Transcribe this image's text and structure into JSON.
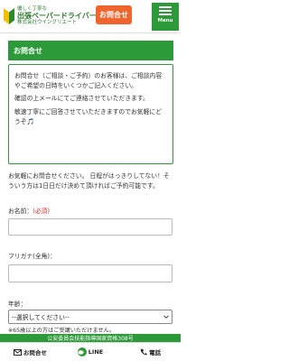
{
  "header": {
    "logo_tagline": "優しく丁寧な",
    "logo_name": "出張ペーパードライバー講習",
    "logo_company": "株式会社ウイングリエート",
    "contact_label": "お問合せ",
    "menu_label": "Menu"
  },
  "section_title": "お問合せ",
  "notice": {
    "p1": "お問合せ（ご相談・ご予約）のお客様は、ご相談内容やご希望の日時をいくつかご記入ください。",
    "p2": "確認の上メールにてご連絡させていただきます。",
    "p3": "敏速丁寧にご回答させていただきますのでお気軽にどうぞ🎵"
  },
  "intro": "お気軽にお問合せください。 日程がはっきりしてない！そういう方は1日日だけ決めて頂ければご予約可能です。",
  "form": {
    "name_label": "お名前：",
    "required_mark": "(必須)",
    "furigana_label": "フリガナ(全角)：",
    "age_label": "年齢：",
    "age_select_value": "--選択してください--",
    "age_note": "※65歳以上の方はご受講いただけません。"
  },
  "footer_band": "公安委員会技能指導国家資格308号",
  "bottom_nav": {
    "contact": "お問合せ",
    "line": "LINE",
    "phone": "電話"
  },
  "colors": {
    "brand_green": "#2d9a3a",
    "accent_orange": "#f0642d",
    "required_red": "#e03030"
  }
}
